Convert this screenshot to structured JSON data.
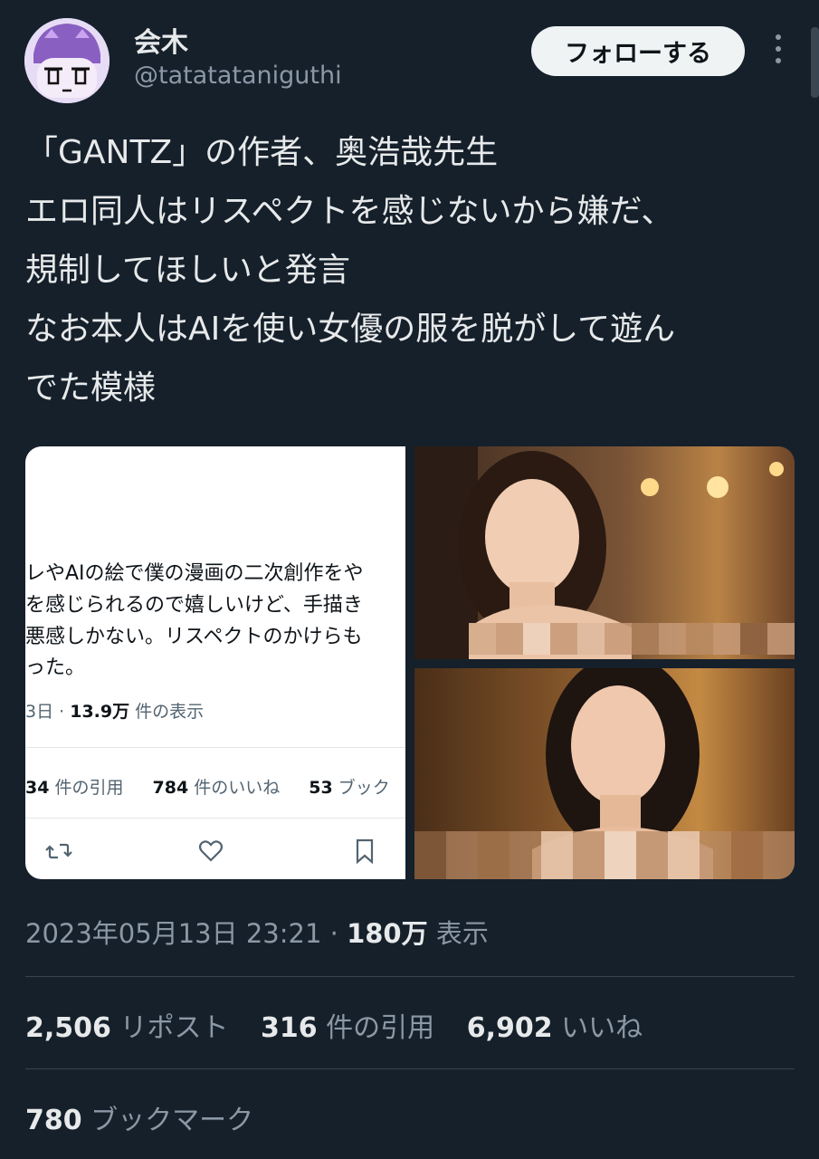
{
  "user": {
    "display_name": "会木",
    "handle": "@tatatataniguthi"
  },
  "follow_button_label": "フォローする",
  "tweet": {
    "lines": [
      "「GANTZ」の作者、奥浩哉先生",
      "エロ同人はリスペクトを感じないから嫌だ、",
      "規制してほしいと発言",
      "なお本人はAIを使い女優の服を脱がして遊ん",
      "でた模様"
    ]
  },
  "embedded_screenshot": {
    "lines": [
      "レやAIの絵で僕の漫画の二次創作をや",
      "を感じられるので嬉しいけど、手描き",
      "悪感しかない。リスペクトのかけらも",
      "った。"
    ],
    "meta_prefix": "3日 · ",
    "meta_views": "13.9万",
    "meta_suffix": " 件の表示",
    "quotes_count": "34",
    "quotes_label": " 件の引用",
    "likes_count": "784",
    "likes_label": " 件のいいね",
    "bookmarks_count": "53",
    "bookmarks_label": " ブック"
  },
  "footer": {
    "timestamp": "2023年05月13日 23:21 · ",
    "views": "180万",
    "views_label": " 表示",
    "reposts_count": "2,506",
    "reposts_label": " リポスト",
    "quotes_count": "316",
    "quotes_label": " 件の引用",
    "likes_count": "6,902",
    "likes_label": " いいね",
    "bookmarks_count": "780",
    "bookmarks_label": " ブックマーク"
  },
  "colors": {
    "background": "#15202b",
    "text_primary": "#e7e9ea",
    "text_secondary": "#8b98a5",
    "follow_button_bg": "#eff3f4"
  }
}
